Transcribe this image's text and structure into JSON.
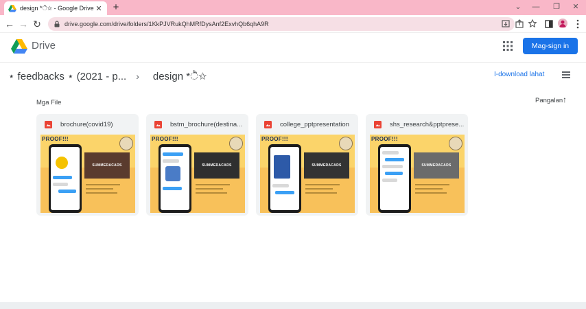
{
  "browser": {
    "tab_title": "design *ੈ✩ - Google Drive",
    "tab_close": "✕",
    "new_tab": "+",
    "window_controls": [
      "⌄",
      "—",
      "❐",
      "✕"
    ],
    "url": "drive.google.com/drive/folders/1KkPJVRukQhMRfDysAnf2ExvhQb6qhA9R",
    "nav": {
      "back": "←",
      "forward": "→",
      "reload": "↻"
    },
    "toolbar_icons": [
      "install-icon",
      "share-icon",
      "star-icon",
      "sidebar-icon",
      "profile-icon",
      "menu-icon"
    ]
  },
  "header": {
    "product_name": "Drive",
    "sign_in_label": "Mag-sign in",
    "accent_color": "#1a73e8"
  },
  "breadcrumb": {
    "parent": "⋆ feedbacks ⋆ (2021 - p...",
    "separator": "›",
    "current": "design *ੈ✩"
  },
  "actions": {
    "download_all": "I-download lahat"
  },
  "files_section": {
    "label": "Mga File",
    "sort_label": "Pangalan",
    "sort_arrow": "↑"
  },
  "files": [
    {
      "name": "brochure(covid19)",
      "type": "pdf",
      "thumb_proof": "PROOF!!!",
      "thumb_title": "SUMMERACADS"
    },
    {
      "name": "bstm_brochure(destina...",
      "type": "pdf",
      "thumb_proof": "PROOF!!!",
      "thumb_title": "SUMMERACADS"
    },
    {
      "name": "college_pptpresentation",
      "type": "pdf",
      "thumb_proof": "PROOF!!!",
      "thumb_title": "SUMMERACADS"
    },
    {
      "name": "shs_research&pptprese...",
      "type": "pdf",
      "thumb_proof": "PROOF!!!",
      "thumb_title": "SUMMERACADS"
    }
  ]
}
